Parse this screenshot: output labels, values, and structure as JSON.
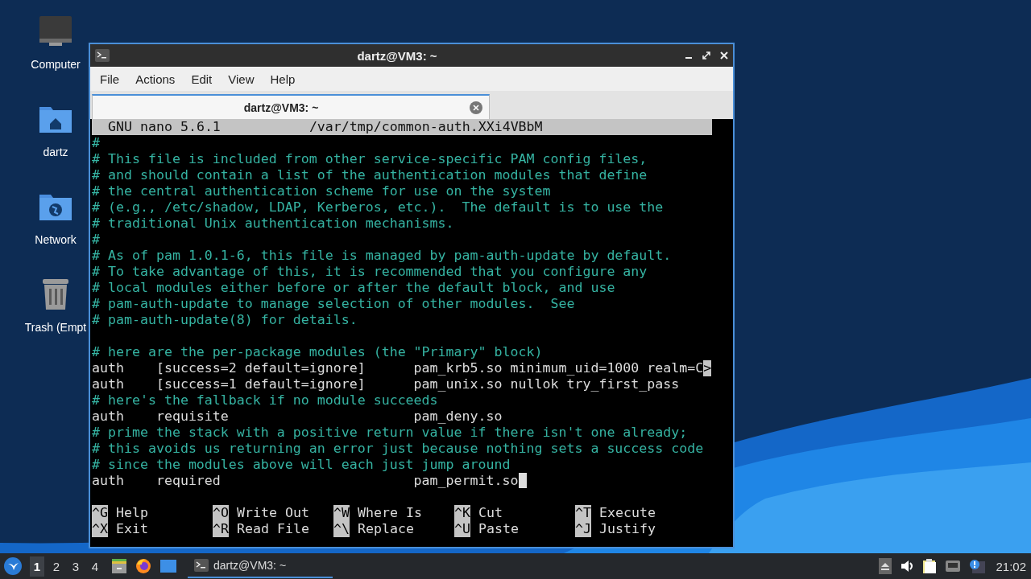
{
  "desktop_icons": [
    {
      "label": "Computer",
      "kind": "computer"
    },
    {
      "label": "dartz",
      "kind": "home"
    },
    {
      "label": "Network",
      "kind": "network"
    },
    {
      "label": "Trash (Empt",
      "kind": "trash"
    }
  ],
  "window": {
    "title": "dartz@VM3: ~",
    "menu": [
      "File",
      "Actions",
      "Edit",
      "View",
      "Help"
    ],
    "tabs": [
      {
        "label": "dartz@VM3: ~",
        "selected": true
      }
    ],
    "editor": {
      "app": "GNU nano 5.6.1",
      "file": "/var/tmp/common-auth.XXi4VBbM",
      "lines": [
        {
          "kind": "comment",
          "text": "#"
        },
        {
          "kind": "comment",
          "text": "# This file is included from other service-specific PAM config files,"
        },
        {
          "kind": "comment",
          "text": "# and should contain a list of the authentication modules that define"
        },
        {
          "kind": "comment",
          "text": "# the central authentication scheme for use on the system"
        },
        {
          "kind": "comment",
          "text": "# (e.g., /etc/shadow, LDAP, Kerberos, etc.).  The default is to use the"
        },
        {
          "kind": "comment",
          "text": "# traditional Unix authentication mechanisms."
        },
        {
          "kind": "comment",
          "text": "#"
        },
        {
          "kind": "comment",
          "text": "# As of pam 1.0.1-6, this file is managed by pam-auth-update by default."
        },
        {
          "kind": "comment",
          "text": "# To take advantage of this, it is recommended that you configure any"
        },
        {
          "kind": "comment",
          "text": "# local modules either before or after the default block, and use"
        },
        {
          "kind": "comment",
          "text": "# pam-auth-update to manage selection of other modules.  See"
        },
        {
          "kind": "comment",
          "text": "# pam-auth-update(8) for details."
        },
        {
          "kind": "blank"
        },
        {
          "kind": "comment",
          "text": "# here are the per-package modules (the \"Primary\" block)"
        },
        {
          "kind": "code",
          "text": "auth    [success=2 default=ignore]      pam_krb5.so minimum_uid=1000 realm=C",
          "overflow": ">"
        },
        {
          "kind": "code",
          "text": "auth    [success=1 default=ignore]      pam_unix.so nullok try_first_pass"
        },
        {
          "kind": "comment",
          "text": "# here's the fallback if no module succeeds"
        },
        {
          "kind": "code",
          "text": "auth    requisite                       pam_deny.so"
        },
        {
          "kind": "comment",
          "text": "# prime the stack with a positive return value if there isn't one already;"
        },
        {
          "kind": "comment",
          "text": "# this avoids us returning an error just because nothing sets a success code"
        },
        {
          "kind": "comment",
          "text": "# since the modules above will each just jump around"
        },
        {
          "kind": "code",
          "text": "auth    required                        pam_permit.so",
          "cursor": true
        },
        {
          "kind": "blank"
        }
      ],
      "shortcuts": [
        [
          {
            "key": "^G",
            "label": "Help"
          },
          {
            "key": "^O",
            "label": "Write Out"
          },
          {
            "key": "^W",
            "label": "Where Is"
          },
          {
            "key": "^K",
            "label": "Cut"
          },
          {
            "key": "^T",
            "label": "Execute"
          }
        ],
        [
          {
            "key": "^X",
            "label": "Exit"
          },
          {
            "key": "^R",
            "label": "Read File"
          },
          {
            "key": "^\\",
            "label": "Replace"
          },
          {
            "key": "^U",
            "label": "Paste"
          },
          {
            "key": "^J",
            "label": "Justify"
          }
        ]
      ]
    }
  },
  "taskbar": {
    "workspaces": [
      {
        "label": "1",
        "selected": true
      },
      {
        "label": "2",
        "selected": false
      },
      {
        "label": "3",
        "selected": false
      },
      {
        "label": "4",
        "selected": false
      }
    ],
    "tasks": [
      {
        "label": "dartz@VM3: ~",
        "selected": true
      }
    ],
    "clock": "21:02"
  }
}
